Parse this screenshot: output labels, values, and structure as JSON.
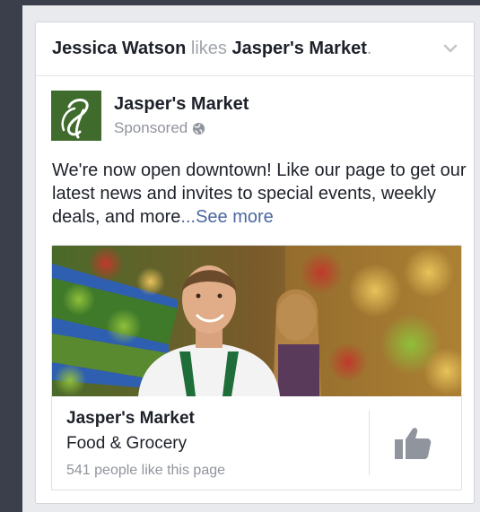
{
  "story": {
    "actor": "Jessica Watson",
    "verb": "likes",
    "page": "Jasper's Market",
    "period": ".",
    "menu_icon": "chevron-down-icon"
  },
  "post": {
    "page_name": "Jasper's Market",
    "sponsored_label": "Sponsored",
    "privacy_icon": "globe-icon",
    "body": "We're now open downtown! Like our page to get our latest news and invites to special events, weekly deals, and more",
    "see_more": "...See more"
  },
  "attachment": {
    "title": "Jasper's Market",
    "category": "Food & Grocery",
    "likes_text": "541 people like this page",
    "like_icon": "thumbs-up-icon"
  },
  "colors": {
    "link": "#4b67a1",
    "logo_green": "#3f6b2d",
    "muted": "#90949c"
  }
}
